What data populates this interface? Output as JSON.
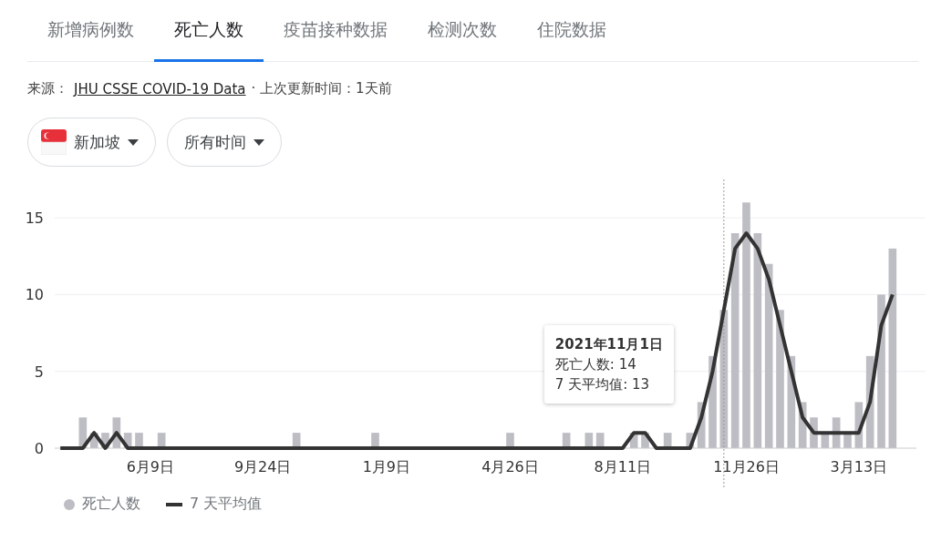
{
  "tabs": [
    {
      "label": "新增病例数",
      "selected": false
    },
    {
      "label": "死亡人数",
      "selected": true
    },
    {
      "label": "疫苗接种数据",
      "selected": false
    },
    {
      "label": "检测次数",
      "selected": false
    },
    {
      "label": "住院数据",
      "selected": false
    }
  ],
  "source": {
    "prefix": "来源：",
    "link": "JHU CSSE COVID-19 Data",
    "suffix": "· 上次更新时间：1天前"
  },
  "filters": [
    {
      "kind": "flag",
      "label": "新加坡"
    },
    {
      "kind": "plain",
      "label": "所有时间"
    }
  ],
  "chart": {
    "chart_data": {
      "type": "bar",
      "categories": [
        null,
        null,
        null,
        null,
        null,
        null,
        null,
        null,
        "6月9日",
        null,
        null,
        null,
        null,
        null,
        null,
        null,
        null,
        null,
        "9月24日",
        null,
        null,
        null,
        null,
        null,
        null,
        null,
        null,
        null,
        null,
        "1月9日",
        null,
        null,
        null,
        null,
        null,
        null,
        null,
        null,
        null,
        null,
        "4月26日",
        null,
        null,
        null,
        null,
        null,
        null,
        null,
        null,
        null,
        "8月11日",
        null,
        null,
        null,
        null,
        null,
        null,
        null,
        null,
        null,
        null,
        "11月26日",
        null,
        null,
        null,
        null,
        null,
        null,
        null,
        null,
        null,
        "3月13日",
        null,
        null,
        null
      ],
      "series": [
        {
          "name": "死亡人数",
          "color": "#bdbdc4",
          "values": [
            0,
            0,
            2,
            1,
            1,
            2,
            1,
            1,
            0,
            1,
            0,
            0,
            0,
            0,
            0,
            0,
            0,
            0,
            0,
            0,
            0,
            1,
            0,
            0,
            0,
            0,
            0,
            0,
            1,
            0,
            0,
            0,
            0,
            0,
            0,
            0,
            0,
            0,
            0,
            0,
            1,
            0,
            0,
            0,
            0,
            1,
            0,
            1,
            1,
            0,
            0,
            1,
            1,
            0,
            1,
            0,
            1,
            3,
            6,
            9,
            14,
            16,
            14,
            12,
            9,
            6,
            3,
            2,
            1,
            2,
            1,
            3,
            6,
            10,
            13
          ]
        },
        {
          "name": "7 天平均值",
          "type": "line",
          "color": "#333333",
          "values": [
            0,
            0,
            0,
            1,
            0,
            1,
            0,
            0,
            0,
            0,
            0,
            0,
            0,
            0,
            0,
            0,
            0,
            0,
            0,
            0,
            0,
            0,
            0,
            0,
            0,
            0,
            0,
            0,
            0,
            0,
            0,
            0,
            0,
            0,
            0,
            0,
            0,
            0,
            0,
            0,
            0,
            0,
            0,
            0,
            0,
            0,
            0,
            0,
            0,
            0,
            0,
            1,
            1,
            0,
            0,
            0,
            0,
            2,
            5,
            9,
            13,
            14,
            13,
            11,
            8,
            5,
            2,
            1,
            1,
            1,
            1,
            1,
            3,
            8,
            10
          ]
        }
      ],
      "ylim": [
        0,
        17.5
      ],
      "yticks": [
        0,
        5,
        10,
        15
      ],
      "grid": true
    },
    "tooltip": {
      "title": "2021年11月1日",
      "lines": [
        "死亡人数: 14",
        "7 天平均值: 13"
      ]
    }
  },
  "legend": [
    {
      "kind": "dot"
    },
    {
      "kind": "line"
    }
  ]
}
